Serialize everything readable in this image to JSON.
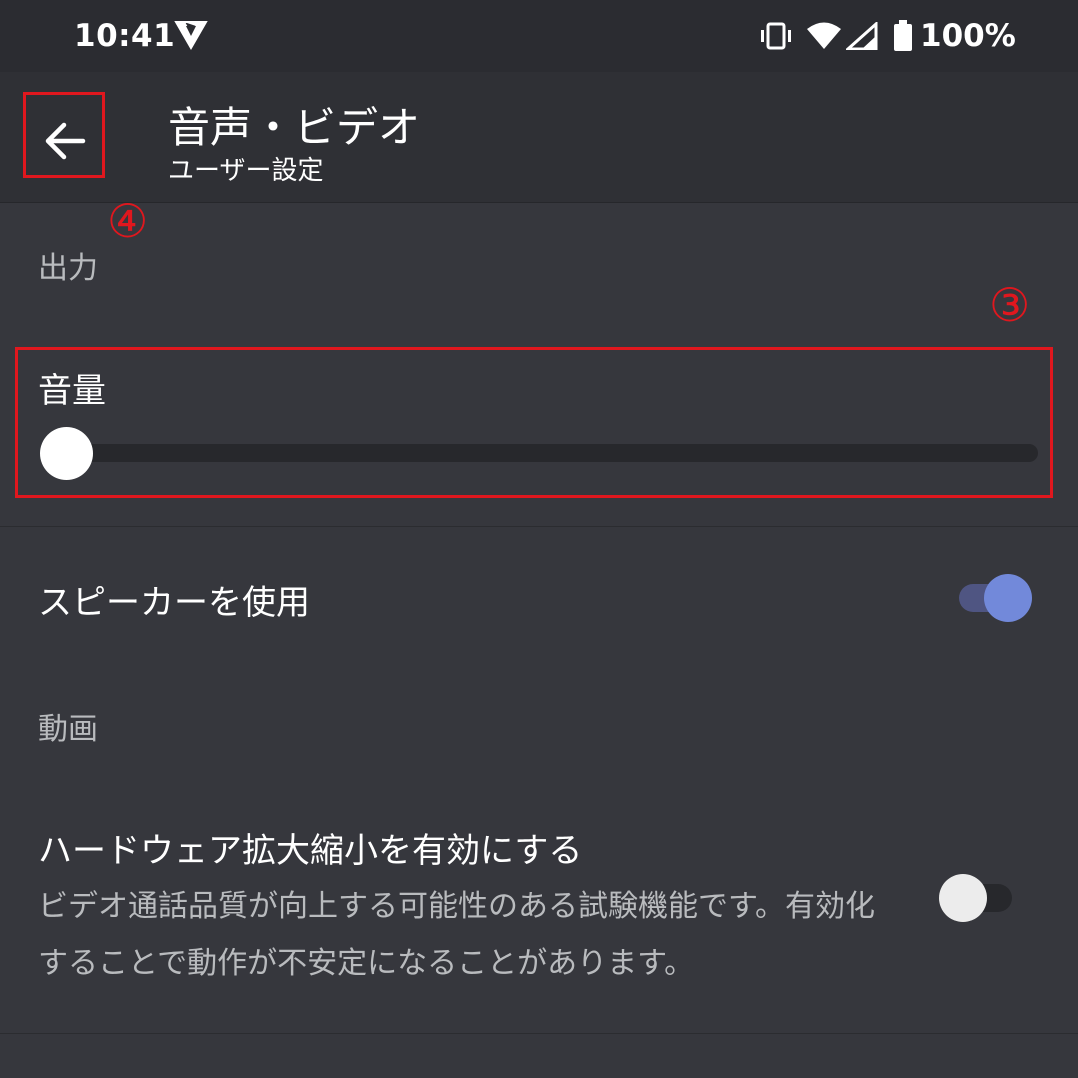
{
  "status_bar": {
    "time": "10:41",
    "battery_percent": "100%",
    "icons": [
      "app-logo-icon",
      "vibrate-icon",
      "wifi-icon",
      "signal-icon",
      "battery-icon"
    ]
  },
  "app_bar": {
    "title": "音声・ビデオ",
    "subtitle": "ユーザー設定"
  },
  "annotations": {
    "mark_back": "④",
    "mark_volume": "③",
    "highlight_color": "#e0171e"
  },
  "output": {
    "section_label": "出力",
    "volume_label": "音量",
    "volume_value": 0,
    "speaker_label": "スピーカーを使用",
    "speaker_enabled": true
  },
  "video": {
    "section_label": "動画",
    "hardware_scaling_label": "ハードウェア拡大縮小を有効にする",
    "hardware_scaling_desc": "ビデオ通話品質が向上する可能性のある試験機能です。有効化することで動作が不安定になることがあります。",
    "hardware_scaling_enabled": false
  },
  "colors": {
    "background": "#36373d",
    "accent": "#7289da",
    "annotation": "#e0171e"
  }
}
